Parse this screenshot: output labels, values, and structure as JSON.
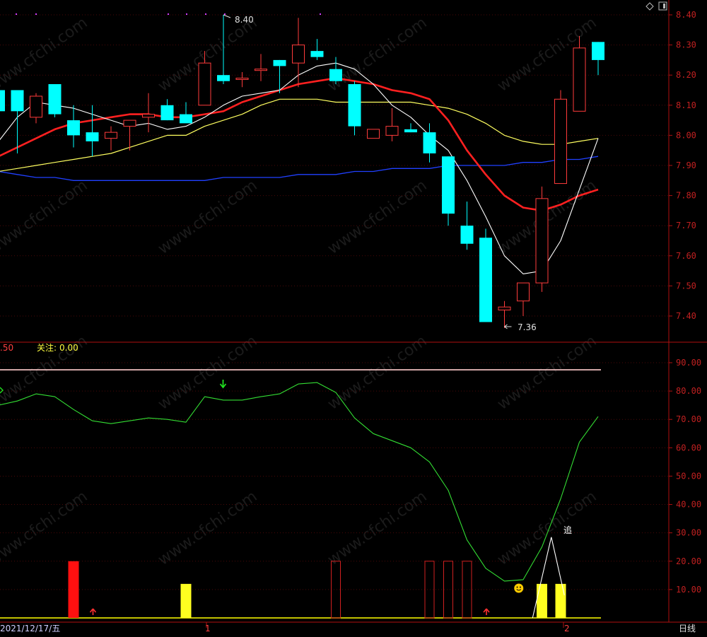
{
  "window": {
    "period_label": "日线",
    "date_label": "2021/12/17/五",
    "icons": [
      "diamond-icon",
      "window-icon"
    ]
  },
  "colors": {
    "background": "#000000",
    "axis": "#b01010",
    "grid": "#4a0808",
    "candle_up": "#ff3b3b",
    "candle_down": "#00ffff",
    "ma5": "#ffffff",
    "ma10": "#ff2020",
    "ma20": "#ffff60",
    "ma60": "#2040ff",
    "indicator_line": "#33dd33",
    "ref_line_top": "#ffcccc",
    "ref_line_bottom": "#ffff00",
    "bar_red": "#ff1010",
    "bar_yellow": "#ffff20",
    "bar_hollow": "#d02020",
    "watermark": "#1f1f1f"
  },
  "watermark_text": "www.cfchi.com",
  "indicator_header": {
    "left_value": ".50",
    "focus_label": "关注:",
    "focus_value": "0.00"
  },
  "annotations": {
    "high_label": "8.40",
    "low_label": "7.36",
    "chase_label": "追",
    "month_markers": [
      "1",
      "2"
    ]
  },
  "chart_data": [
    {
      "type": "candlestick",
      "ylim": [
        7.33,
        8.45
      ],
      "y_ticks": [
        "8.40",
        "8.30",
        "8.20",
        "8.10",
        "8.00",
        "7.90",
        "7.80",
        "7.70",
        "7.60",
        "7.50",
        "7.40"
      ],
      "candles": [
        {
          "o": 8.15,
          "h": 8.15,
          "l": 8.08,
          "c": 8.08
        },
        {
          "o": 8.15,
          "h": 8.15,
          "l": 7.94,
          "c": 8.08
        },
        {
          "o": 8.06,
          "h": 8.14,
          "l": 8.04,
          "c": 8.13
        },
        {
          "o": 8.17,
          "h": 8.17,
          "l": 8.06,
          "c": 8.07
        },
        {
          "o": 8.05,
          "h": 8.1,
          "l": 7.96,
          "c": 8.0
        },
        {
          "o": 8.01,
          "h": 8.1,
          "l": 7.93,
          "c": 7.98
        },
        {
          "o": 7.99,
          "h": 8.03,
          "l": 7.95,
          "c": 8.01
        },
        {
          "o": 8.03,
          "h": 8.05,
          "l": 7.95,
          "c": 8.05
        },
        {
          "o": 8.06,
          "h": 8.14,
          "l": 8.01,
          "c": 8.07
        },
        {
          "o": 8.1,
          "h": 8.12,
          "l": 8.05,
          "c": 8.05
        },
        {
          "o": 8.07,
          "h": 8.11,
          "l": 8.05,
          "c": 8.04
        },
        {
          "o": 8.1,
          "h": 8.28,
          "l": 8.1,
          "c": 8.24
        },
        {
          "o": 8.2,
          "h": 8.4,
          "l": 8.17,
          "c": 8.18
        },
        {
          "o": 8.19,
          "h": 8.21,
          "l": 8.16,
          "c": 8.19
        },
        {
          "o": 8.22,
          "h": 8.27,
          "l": 8.18,
          "c": 8.22
        },
        {
          "o": 8.25,
          "h": 8.25,
          "l": 8.14,
          "c": 8.23
        },
        {
          "o": 8.24,
          "h": 8.39,
          "l": 8.16,
          "c": 8.3
        },
        {
          "o": 8.28,
          "h": 8.32,
          "l": 8.25,
          "c": 8.26
        },
        {
          "o": 8.22,
          "h": 8.26,
          "l": 8.17,
          "c": 8.18
        },
        {
          "o": 8.17,
          "h": 8.18,
          "l": 8.0,
          "c": 8.03
        },
        {
          "o": 7.99,
          "h": 8.02,
          "l": 7.99,
          "c": 8.02
        },
        {
          "o": 8.0,
          "h": 8.09,
          "l": 7.98,
          "c": 8.03
        },
        {
          "o": 8.02,
          "h": 8.04,
          "l": 8.01,
          "c": 8.01
        },
        {
          "o": 8.01,
          "h": 8.04,
          "l": 7.91,
          "c": 7.94
        },
        {
          "o": 7.93,
          "h": 7.93,
          "l": 7.7,
          "c": 7.74
        },
        {
          "o": 7.7,
          "h": 7.78,
          "l": 7.62,
          "c": 7.64
        },
        {
          "o": 7.66,
          "h": 7.69,
          "l": 7.38,
          "c": 7.38
        },
        {
          "o": 7.42,
          "h": 7.45,
          "l": 7.36,
          "c": 7.43
        },
        {
          "o": 7.45,
          "h": 7.51,
          "l": 7.4,
          "c": 7.51
        },
        {
          "o": 7.51,
          "h": 7.83,
          "l": 7.48,
          "c": 7.79
        },
        {
          "o": 7.84,
          "h": 8.15,
          "l": 7.84,
          "c": 8.12
        },
        {
          "o": 8.08,
          "h": 8.33,
          "l": 8.08,
          "c": 8.29
        },
        {
          "o": 8.31,
          "h": 8.31,
          "l": 8.2,
          "c": 8.25
        }
      ],
      "ma5": [
        7.98,
        8.06,
        8.11,
        8.1,
        8.09,
        8.07,
        8.05,
        8.03,
        8.04,
        8.02,
        8.03,
        8.06,
        8.1,
        8.13,
        8.14,
        8.15,
        8.2,
        8.23,
        8.24,
        8.22,
        8.17,
        8.1,
        8.06,
        8.0,
        7.95,
        7.85,
        7.73,
        7.6,
        7.54,
        7.55,
        7.65,
        7.82,
        7.99
      ],
      "ma10": [
        7.93,
        7.96,
        7.99,
        8.02,
        8.04,
        8.05,
        8.06,
        8.07,
        8.07,
        8.06,
        8.06,
        8.07,
        8.08,
        8.11,
        8.13,
        8.15,
        8.17,
        8.18,
        8.19,
        8.18,
        8.17,
        8.15,
        8.14,
        8.12,
        8.05,
        7.95,
        7.87,
        7.8,
        7.76,
        7.75,
        7.77,
        7.8,
        7.82
      ],
      "ma20": [
        7.88,
        7.89,
        7.9,
        7.91,
        7.92,
        7.93,
        7.94,
        7.96,
        7.98,
        8.0,
        8.0,
        8.03,
        8.05,
        8.07,
        8.1,
        8.12,
        8.12,
        8.12,
        8.11,
        8.11,
        8.11,
        8.11,
        8.11,
        8.1,
        8.09,
        8.07,
        8.04,
        8.0,
        7.98,
        7.97,
        7.97,
        7.98,
        7.99
      ],
      "ma60": [
        7.88,
        7.87,
        7.86,
        7.86,
        7.85,
        7.85,
        7.85,
        7.85,
        7.85,
        7.85,
        7.85,
        7.85,
        7.86,
        7.86,
        7.86,
        7.86,
        7.87,
        7.87,
        7.87,
        7.88,
        7.88,
        7.89,
        7.89,
        7.89,
        7.9,
        7.9,
        7.9,
        7.9,
        7.91,
        7.91,
        7.92,
        7.92,
        7.93
      ]
    },
    {
      "type": "line",
      "ylim": [
        0,
        97
      ],
      "y_ticks": [
        "90.00",
        "80.00",
        "70.00",
        "60.00",
        "50.00",
        "40.00",
        "30.00",
        "20.00",
        "10.00"
      ],
      "reference_lines": [
        87.5,
        0
      ],
      "line_values": [
        75,
        76.5,
        79,
        78,
        73.5,
        69.5,
        68.5,
        69.5,
        70.5,
        70,
        69,
        78,
        76.8,
        76.8,
        78,
        79,
        82.5,
        83,
        79.5,
        70.5,
        65,
        62.5,
        60,
        55,
        45,
        27.5,
        17.5,
        13,
        13.5,
        25,
        42,
        62,
        71
      ],
      "bars": [
        {
          "i": 4,
          "v": 20,
          "style": "filled-red"
        },
        {
          "i": 10,
          "v": 12,
          "style": "filled-yellow"
        },
        {
          "i": 18,
          "v": 20,
          "style": "hollow"
        },
        {
          "i": 23,
          "v": 20,
          "style": "hollow"
        },
        {
          "i": 24,
          "v": 20,
          "style": "hollow"
        },
        {
          "i": 25,
          "v": 20,
          "style": "hollow"
        },
        {
          "i": 29,
          "v": 12,
          "style": "filled-yellow"
        },
        {
          "i": 30,
          "v": 12,
          "style": "filled-yellow"
        }
      ],
      "chase_line": [
        [
          28.5,
          0
        ],
        [
          29.5,
          28.5
        ],
        [
          30.2,
          8
        ]
      ],
      "buy_arrows": [
        5,
        26
      ],
      "sell_arrow": 11,
      "smiley_index": 27.5
    }
  ]
}
